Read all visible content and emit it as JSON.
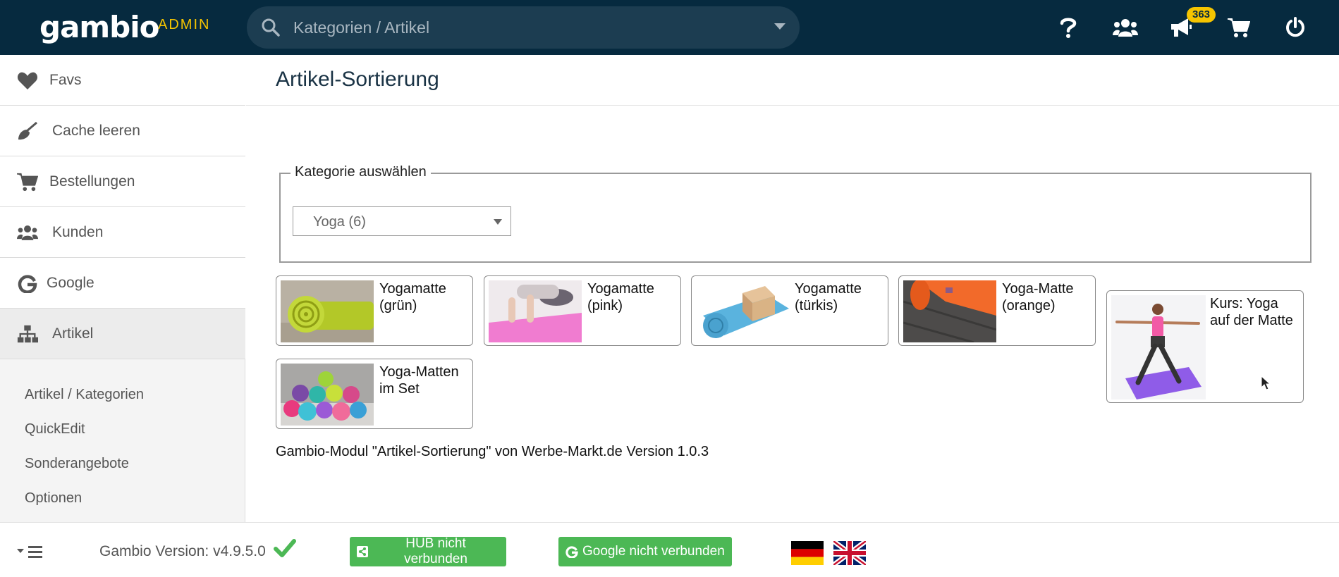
{
  "header": {
    "logo": "gambio",
    "admin_label": "ADMIN",
    "search_placeholder": "Kategorien / Artikel",
    "notification_count": "363",
    "icons": [
      "help-icon",
      "users-icon",
      "megaphone-icon",
      "cart-icon",
      "power-icon"
    ]
  },
  "sidebar": {
    "items": [
      {
        "label": "Favs",
        "icon": "heart-icon"
      },
      {
        "label": "Cache leeren",
        "icon": "broom-icon"
      },
      {
        "label": "Bestellungen",
        "icon": "cart-icon"
      },
      {
        "label": "Kunden",
        "icon": "users-icon"
      },
      {
        "label": "Google",
        "icon": "google-icon"
      },
      {
        "label": "Artikel",
        "icon": "sitemap-icon"
      }
    ],
    "subitems": [
      "Artikel / Kategorien",
      "QuickEdit",
      "Sonderangebote",
      "Optionen"
    ]
  },
  "main": {
    "title": "Artikel-Sortierung",
    "category_legend": "Kategorie auswählen",
    "category_selected": "Yoga (6)",
    "products": [
      {
        "name": "Yogamatte (grün)",
        "image": "green-rolled-mat"
      },
      {
        "name": "Yogamatte (pink)",
        "image": "pink-mat-person"
      },
      {
        "name": "Yogamatte (türkis)",
        "image": "turquoise-mat-blocks"
      },
      {
        "name": "Yoga-Matte (orange)",
        "image": "orange-mat-wood"
      },
      {
        "name": "Kurs: Yoga auf der Matte",
        "image": "woman-yoga-pose"
      },
      {
        "name": "Yoga-Matten im Set",
        "image": "colorful-mats-set"
      }
    ],
    "module_info": "Gambio-Modul \"Artikel-Sortierung\" von Werbe-Markt.de Version 1.0.3"
  },
  "footer": {
    "version": "Gambio Version: v4.9.5.0",
    "hub_button": "HUB nicht verbunden",
    "google_button": "Google nicht verbunden",
    "languages": [
      "de",
      "en"
    ]
  },
  "colors": {
    "header_bg": "#062a3f",
    "accent_yellow": "#f5c400",
    "button_green": "#4cb855"
  }
}
